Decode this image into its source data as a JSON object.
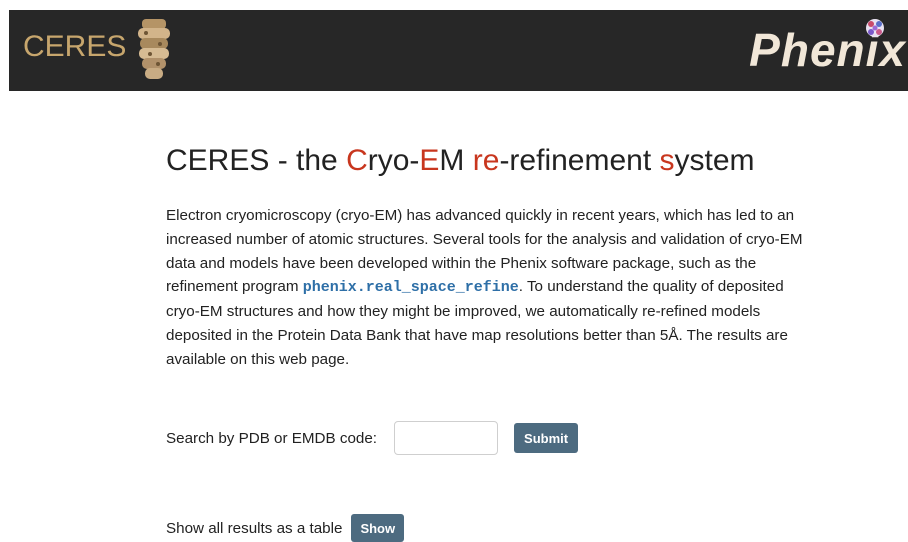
{
  "header": {
    "ceres_logo": "CERES",
    "phenix_logo": "Phenix"
  },
  "main": {
    "title_parts": [
      "CERES - the ",
      "C",
      "ryo-",
      "E",
      "M ",
      "re",
      "-refinement ",
      "s",
      "ystem"
    ],
    "intro_before_code": "Electron cryomicroscopy (cryo-EM) has advanced quickly in recent years, which has led to an increased number of atomic structures. Several tools for the analysis and validation of cryo-EM data and models have been developed within the Phenix software package, such as the refinement program ",
    "code": "phenix.real_space_refine",
    "intro_after_code": ". To understand the quality of deposited cryo-EM structures and how they might be improved, we automatically re-refined models deposited in the Protein Data Bank that have map resolutions better than 5Å. The results are available on this web page."
  },
  "search": {
    "label": "Search by PDB or EMDB code:",
    "value": "",
    "placeholder": "",
    "submit_label": "Submit"
  },
  "results": {
    "label": "Show all results as a table",
    "show_label": "Show"
  },
  "colors": {
    "header_bg": "#272727",
    "accent": "#c8361e",
    "button": "#4d6b80",
    "code": "#2e6fa7"
  },
  "icons": {
    "ceres": "ceres-molecule-icon",
    "phenix": "phenix-molecule-icon"
  }
}
